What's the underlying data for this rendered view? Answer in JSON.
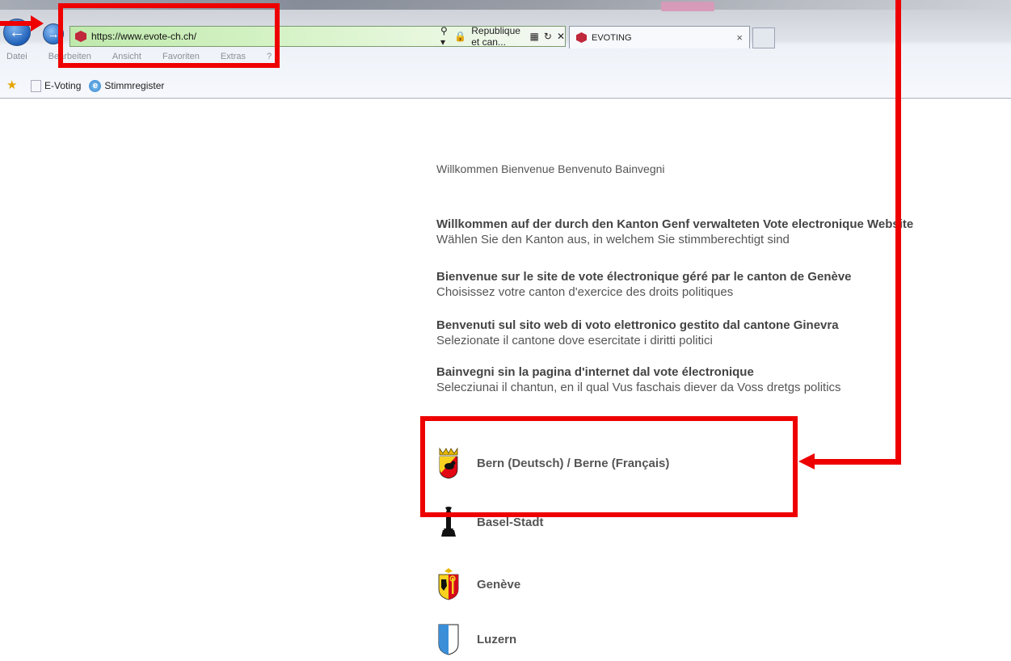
{
  "browser": {
    "url": "https://www.evote-ch.ch/",
    "site_identity": "Republique et can...",
    "tab_title": "EVOTING",
    "tab_close": "×",
    "menu": [
      "Datei",
      "Bearbeiten",
      "Ansicht",
      "Favoriten",
      "Extras",
      "?"
    ],
    "favorites": [
      "E-Voting",
      "Stimmregister"
    ]
  },
  "page": {
    "welcome": "Willkommen Bienvenue Benvenuto Bainvegni",
    "messages": [
      {
        "title": "Willkommen auf der durch den Kanton Genf verwalteten Vote electronique Website",
        "subtitle": "Wählen Sie den Kanton aus, in welchem Sie stimmberechtigt sind"
      },
      {
        "title": "Bienvenue sur le site de vote électronique géré par le canton de Genève",
        "subtitle": "Choisissez votre canton d'exercice des droits politiques"
      },
      {
        "title": "Benvenuti sul sito web di voto elettronico gestito dal cantone Ginevra",
        "subtitle": "Selezionate il cantone dove esercitate i diritti politici"
      },
      {
        "title": "Bainvegni sin la pagina d'internet dal vote électronique",
        "subtitle": "Selecziunai il chantun, en il qual Vus faschais diever da Voss dretgs politics"
      }
    ],
    "cantons": [
      {
        "label": "Bern (Deutsch) / Berne (Français)",
        "icon": "bern-crest-icon"
      },
      {
        "label": "Basel-Stadt",
        "icon": "basel-crest-icon"
      },
      {
        "label": "Genève",
        "icon": "geneve-crest-icon"
      },
      {
        "label": "Luzern",
        "icon": "luzern-crest-icon"
      }
    ]
  },
  "annotation_color": "#ee0000"
}
